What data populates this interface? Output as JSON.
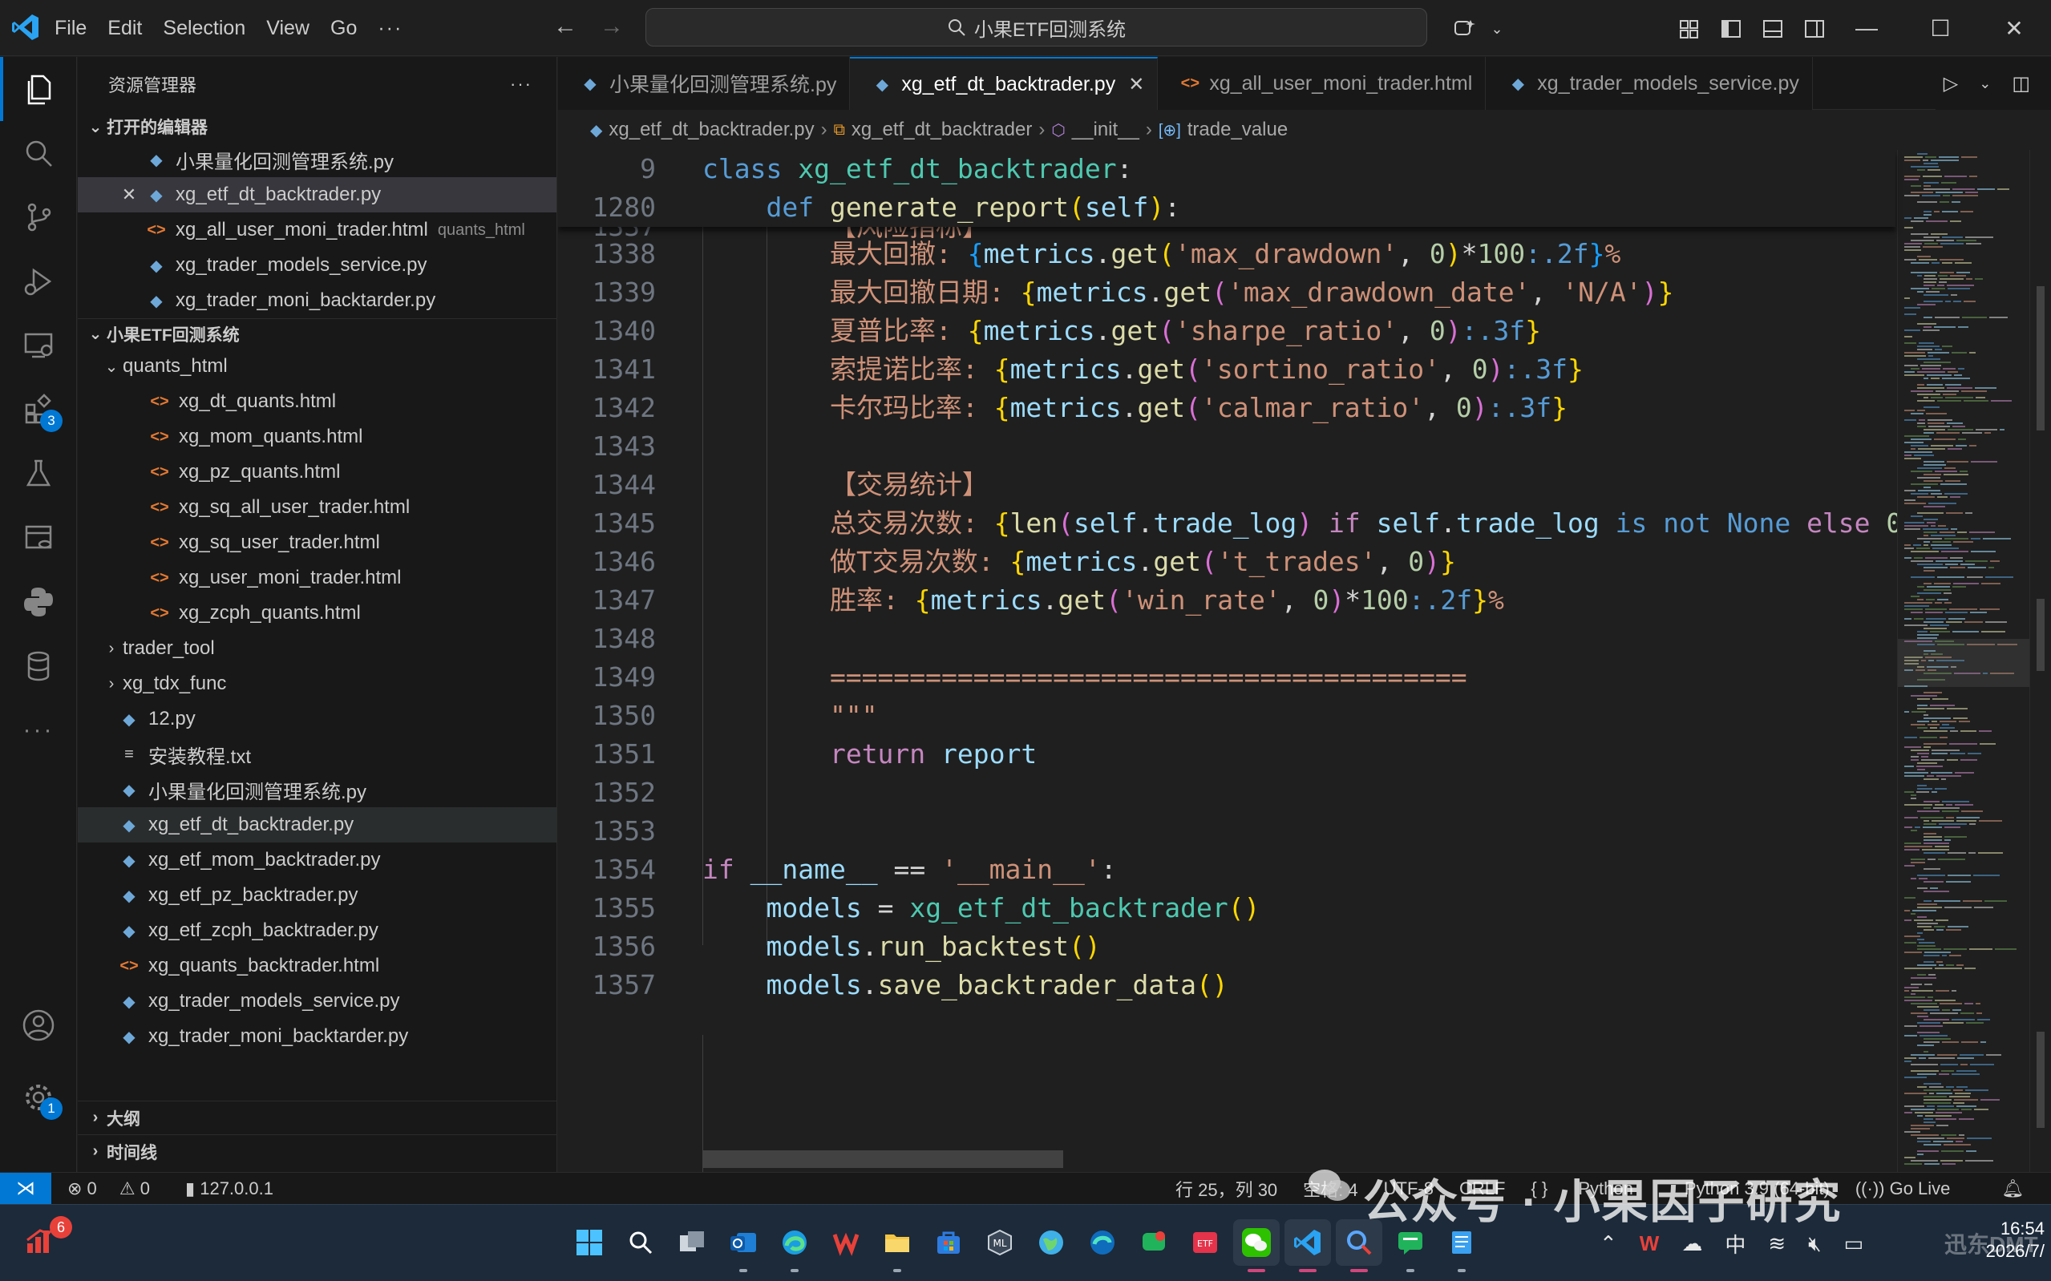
{
  "menu": [
    "File",
    "Edit",
    "Selection",
    "View",
    "Go"
  ],
  "menu_more": "···",
  "command_center": "小果ETF回测系统",
  "explorer": {
    "title": "资源管理器",
    "open_editors_label": "打开的编辑器",
    "open_editors": [
      {
        "name": "小果量化回测管理系统.py",
        "type": "py",
        "desc": ""
      },
      {
        "name": "xg_etf_dt_backtrader.py",
        "type": "py",
        "desc": "",
        "selected": true
      },
      {
        "name": "xg_all_user_moni_trader.html",
        "type": "html",
        "desc": "quants_html"
      },
      {
        "name": "xg_trader_models_service.py",
        "type": "py",
        "desc": ""
      },
      {
        "name": "xg_trader_moni_backtarder.py",
        "type": "py",
        "desc": ""
      }
    ],
    "project_label": "小果ETF回测系统",
    "folder": "quants_html",
    "folder_files": [
      "xg_dt_quants.html",
      "xg_mom_quants.html",
      "xg_pz_quants.html",
      "xg_sq_all_user_trader.html",
      "xg_sq_user_trader.html",
      "xg_user_moni_trader.html",
      "xg_zcph_quants.html"
    ],
    "subfolders": [
      "trader_tool",
      "xg_tdx_func"
    ],
    "files": [
      {
        "name": "12.py",
        "type": "py"
      },
      {
        "name": "安装教程.txt",
        "type": "txt"
      },
      {
        "name": "小果量化回测管理系统.py",
        "type": "py"
      },
      {
        "name": "xg_etf_dt_backtrader.py",
        "type": "py",
        "selected": true
      },
      {
        "name": "xg_etf_mom_backtrader.py",
        "type": "py"
      },
      {
        "name": "xg_etf_pz_backtrader.py",
        "type": "py"
      },
      {
        "name": "xg_etf_zcph_backtrader.py",
        "type": "py"
      },
      {
        "name": "xg_quants_backtrader.html",
        "type": "html"
      },
      {
        "name": "xg_trader_models_service.py",
        "type": "py"
      },
      {
        "name": "xg_trader_moni_backtarder.py",
        "type": "py"
      }
    ],
    "outline_label": "大纲",
    "timeline_label": "时间线"
  },
  "tabs": [
    {
      "label": "小果量化回测管理系统.py",
      "type": "py"
    },
    {
      "label": "xg_etf_dt_backtrader.py",
      "type": "py",
      "active": true
    },
    {
      "label": "xg_all_user_moni_trader.html",
      "type": "html"
    },
    {
      "label": "xg_trader_models_service.py",
      "type": "py"
    }
  ],
  "breadcrumb": [
    "xg_etf_dt_backtrader.py",
    "xg_etf_dt_backtrader",
    "__init__",
    "trade_value"
  ],
  "badges": {
    "extensions": "3",
    "settings": "1"
  },
  "statusbar": {
    "errors": "0",
    "warnings": "0",
    "server": "127.0.0.1",
    "position": "行 25，列 30",
    "spaces": "空格: 4",
    "encoding": "UTF-8",
    "eol": "CRLF",
    "lang_braces": "{ }",
    "language": "Python",
    "interpreter": "Python 3.9 (64-bit)",
    "golive": "Go Live"
  },
  "watermark": "公众号 · 小果因子研究",
  "taskbar": {
    "notif_count": "6",
    "ime": "中",
    "time": "16:54",
    "date": "2026/7/",
    "corner": "迅东DMT"
  },
  "colors": {
    "accent": "#0078d4",
    "editor_bg": "#1f1f1f",
    "sidebar_bg": "#181818"
  }
}
